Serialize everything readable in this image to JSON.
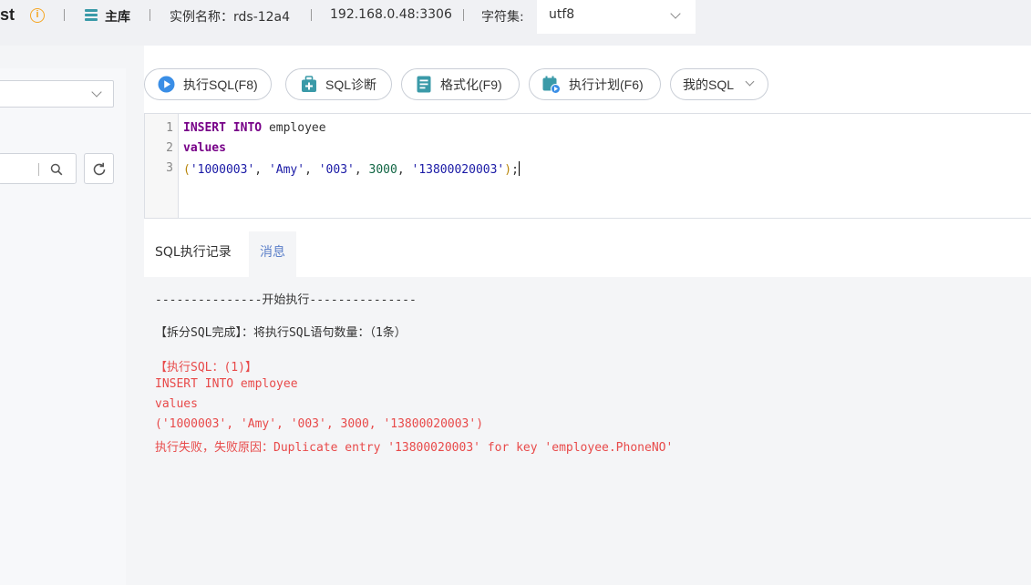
{
  "topbar": {
    "title_fragment": "st",
    "db_role": "主库",
    "instance_label": "实例名称：rds-12a4",
    "address": "192.168.0.48:3306",
    "charset_label": "字符集:",
    "charset_value": "utf8"
  },
  "toolbar": {
    "run_sql": "执行SQL(F8)",
    "diagnose": "SQL诊断",
    "format": "格式化(F9)",
    "explain": "执行计划(F6)",
    "my_sql": "我的SQL"
  },
  "editor": {
    "line_numbers": [
      "1",
      "2",
      "3"
    ],
    "line1_kw1": "INSERT",
    "line1_kw2": "INTO",
    "line1_table": "employee",
    "line2_kw": "values",
    "line3_open": "(",
    "line3_v1": "'1000003'",
    "line3_v2": "'Amy'",
    "line3_v3": "'003'",
    "line3_v4": "3000",
    "line3_v5": "'13800020003'",
    "line3_close": ")",
    "line3_end": ";"
  },
  "tabs": {
    "history": "SQL执行记录",
    "messages": "消息"
  },
  "messages": {
    "start": "---------------开始执行---------------",
    "split_done": "【拆分SQL完成】：将执行SQL语句数量：（1条）",
    "exec_header": "【执行SQL：(1)】",
    "sql_line1": "INSERT INTO employee",
    "sql_line2": "values",
    "sql_line3": "('1000003', 'Amy', '003', 3000, '13800020003')",
    "error": "执行失败，失败原因：Duplicate entry '13800020003' for key 'employee.PhoneNO'"
  },
  "colors": {
    "accent_blue": "#3a8ee6",
    "tab_active": "#5b7fc9",
    "error_red": "#e84a4a",
    "warning_orange": "#f5a623"
  }
}
